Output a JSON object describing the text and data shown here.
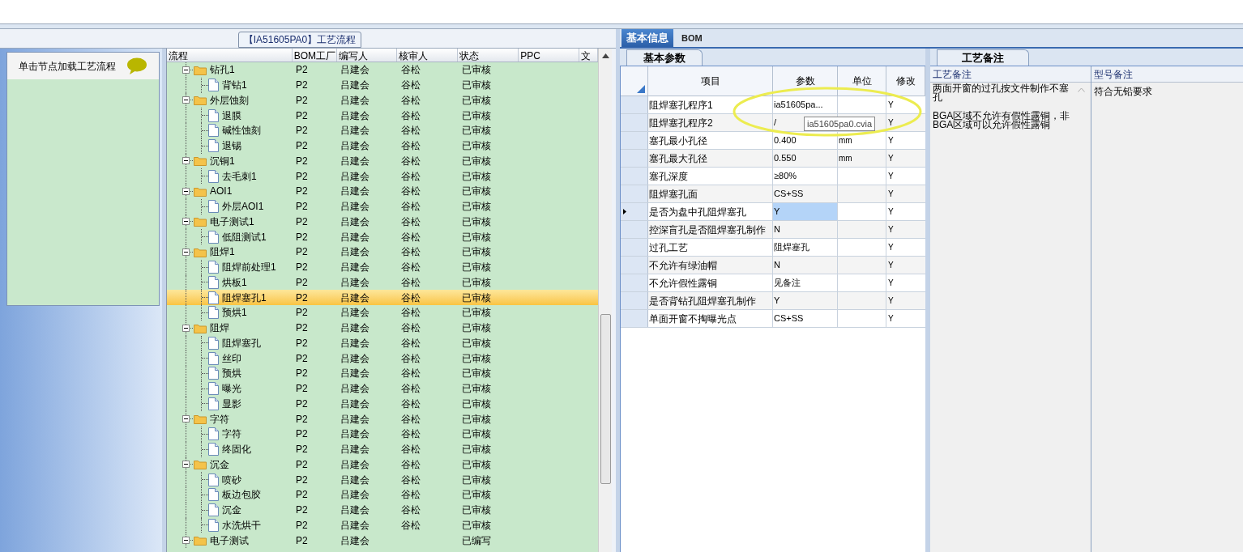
{
  "flow_title": "【IA51605PA0】工艺流程",
  "left_panel": {
    "hint": "单击节点加载工艺流程"
  },
  "tree": {
    "columns": [
      "流程",
      "BOM工厂",
      "编写人",
      "核审人",
      "状态",
      "PPC",
      "文"
    ],
    "rows": [
      {
        "name": "钻孔1",
        "bom": "P2",
        "writer": "吕建会",
        "reviewer": "谷松",
        "status": "已审核",
        "expanded": true,
        "selected": false,
        "children": [
          {
            "name": "背钻1",
            "bom": "P2",
            "writer": "吕建会",
            "reviewer": "谷松",
            "status": "已审核",
            "selected": false
          }
        ]
      },
      {
        "name": "外层蚀刻",
        "bom": "P2",
        "writer": "吕建会",
        "reviewer": "谷松",
        "status": "已审核",
        "expanded": true,
        "selected": false,
        "children": [
          {
            "name": "退膜",
            "bom": "P2",
            "writer": "吕建会",
            "reviewer": "谷松",
            "status": "已审核",
            "selected": false
          },
          {
            "name": "碱性蚀刻",
            "bom": "P2",
            "writer": "吕建会",
            "reviewer": "谷松",
            "status": "已审核",
            "selected": false
          },
          {
            "name": "退锡",
            "bom": "P2",
            "writer": "吕建会",
            "reviewer": "谷松",
            "status": "已审核",
            "selected": false
          }
        ]
      },
      {
        "name": "沉铜1",
        "bom": "P2",
        "writer": "吕建会",
        "reviewer": "谷松",
        "status": "已审核",
        "expanded": true,
        "selected": false,
        "children": [
          {
            "name": "去毛刺1",
            "bom": "P2",
            "writer": "吕建会",
            "reviewer": "谷松",
            "status": "已审核",
            "selected": false
          }
        ]
      },
      {
        "name": "AOI1",
        "bom": "P2",
        "writer": "吕建会",
        "reviewer": "谷松",
        "status": "已审核",
        "expanded": true,
        "selected": false,
        "children": [
          {
            "name": "外层AOI1",
            "bom": "P2",
            "writer": "吕建会",
            "reviewer": "谷松",
            "status": "已审核",
            "selected": false
          }
        ]
      },
      {
        "name": "电子测试1",
        "bom": "P2",
        "writer": "吕建会",
        "reviewer": "谷松",
        "status": "已审核",
        "expanded": true,
        "selected": false,
        "children": [
          {
            "name": "低阻测试1",
            "bom": "P2",
            "writer": "吕建会",
            "reviewer": "谷松",
            "status": "已审核",
            "selected": false
          }
        ]
      },
      {
        "name": "阻焊1",
        "bom": "P2",
        "writer": "吕建会",
        "reviewer": "谷松",
        "status": "已审核",
        "expanded": true,
        "selected": false,
        "children": [
          {
            "name": "阻焊前处理1",
            "bom": "P2",
            "writer": "吕建会",
            "reviewer": "谷松",
            "status": "已审核",
            "selected": false
          },
          {
            "name": "烘板1",
            "bom": "P2",
            "writer": "吕建会",
            "reviewer": "谷松",
            "status": "已审核",
            "selected": false
          },
          {
            "name": "阻焊塞孔1",
            "bom": "P2",
            "writer": "吕建会",
            "reviewer": "谷松",
            "status": "已审核",
            "selected": true
          },
          {
            "name": "预烘1",
            "bom": "P2",
            "writer": "吕建会",
            "reviewer": "谷松",
            "status": "已审核",
            "selected": false
          }
        ]
      },
      {
        "name": "阻焊",
        "bom": "P2",
        "writer": "吕建会",
        "reviewer": "谷松",
        "status": "已审核",
        "expanded": true,
        "selected": false,
        "children": [
          {
            "name": "阻焊塞孔",
            "bom": "P2",
            "writer": "吕建会",
            "reviewer": "谷松",
            "status": "已审核",
            "selected": false
          },
          {
            "name": "丝印",
            "bom": "P2",
            "writer": "吕建会",
            "reviewer": "谷松",
            "status": "已审核",
            "selected": false
          },
          {
            "name": "预烘",
            "bom": "P2",
            "writer": "吕建会",
            "reviewer": "谷松",
            "status": "已审核",
            "selected": false
          },
          {
            "name": "曝光",
            "bom": "P2",
            "writer": "吕建会",
            "reviewer": "谷松",
            "status": "已审核",
            "selected": false
          },
          {
            "name": "显影",
            "bom": "P2",
            "writer": "吕建会",
            "reviewer": "谷松",
            "status": "已审核",
            "selected": false
          }
        ]
      },
      {
        "name": "字符",
        "bom": "P2",
        "writer": "吕建会",
        "reviewer": "谷松",
        "status": "已审核",
        "expanded": true,
        "selected": false,
        "children": [
          {
            "name": "字符",
            "bom": "P2",
            "writer": "吕建会",
            "reviewer": "谷松",
            "status": "已审核",
            "selected": false
          },
          {
            "name": "终固化",
            "bom": "P2",
            "writer": "吕建会",
            "reviewer": "谷松",
            "status": "已审核",
            "selected": false
          }
        ]
      },
      {
        "name": "沉金",
        "bom": "P2",
        "writer": "吕建会",
        "reviewer": "谷松",
        "status": "已审核",
        "expanded": true,
        "selected": false,
        "children": [
          {
            "name": "喷砂",
            "bom": "P2",
            "writer": "吕建会",
            "reviewer": "谷松",
            "status": "已审核",
            "selected": false
          },
          {
            "name": "板边包胶",
            "bom": "P2",
            "writer": "吕建会",
            "reviewer": "谷松",
            "status": "已审核",
            "selected": false
          },
          {
            "name": "沉金",
            "bom": "P2",
            "writer": "吕建会",
            "reviewer": "谷松",
            "status": "已审核",
            "selected": false
          },
          {
            "name": "水洗烘干",
            "bom": "P2",
            "writer": "吕建会",
            "reviewer": "谷松",
            "status": "已审核",
            "selected": false
          }
        ]
      },
      {
        "name": "电子测试",
        "bom": "P2",
        "writer": "吕建会",
        "status": "已编写",
        "expanded": true,
        "selected": false
      }
    ]
  },
  "main_tabs": [
    {
      "label": "基本信息",
      "selected": true
    },
    {
      "label": "BOM",
      "selected": false
    }
  ],
  "params": {
    "tab": "基本参数",
    "columns": [
      "项目",
      "参数",
      "单位",
      "修改"
    ],
    "rows": [
      {
        "item": "阻焊塞孔程序1",
        "value": "ia51605pa...",
        "modified": "Y",
        "selected": false
      },
      {
        "item": "阻焊塞孔程序2",
        "value": "/",
        "modified": "Y",
        "selected": false
      },
      {
        "item": "塞孔最小孔径",
        "value": "0.400",
        "unit": "mm",
        "modified": "Y",
        "selected": false
      },
      {
        "item": "塞孔最大孔径",
        "value": "0.550",
        "unit": "mm",
        "modified": "Y",
        "selected": false
      },
      {
        "item": "塞孔深度",
        "value": "≥80%",
        "modified": "Y",
        "selected": false
      },
      {
        "item": "阻焊塞孔面",
        "value": "CS+SS",
        "modified": "Y",
        "selected": false
      },
      {
        "item": "是否为盘中孔阻焊塞孔",
        "value": "Y",
        "modified": "Y",
        "selected": true
      },
      {
        "item": "控深盲孔是否阻焊塞孔制作",
        "value": "N",
        "modified": "Y",
        "selected": false
      },
      {
        "item": "过孔工艺",
        "value": "阻焊塞孔",
        "modified": "Y",
        "selected": false
      },
      {
        "item": "不允许有绿油帽",
        "value": "N",
        "modified": "Y",
        "selected": false
      },
      {
        "item": "不允许假性露铜",
        "value": "见备注",
        "modified": "Y",
        "selected": false
      },
      {
        "item": "是否背钻孔阻焊塞孔制作",
        "value": "Y",
        "modified": "Y",
        "selected": false
      },
      {
        "item": "单面开窗不掏曝光点",
        "value": "CS+SS",
        "modified": "Y",
        "selected": false
      }
    ],
    "tooltip": "ia51605pa0.cvia"
  },
  "notes": {
    "tab": "工艺备注",
    "columns": [
      "工艺备注",
      "型号备注"
    ],
    "process_note": [
      "两面开窗的过孔按文件制作不塞孔",
      "BGA区域不允许有假性露铜，非BGA区域可以允许假性露铜"
    ],
    "model_note": "符合无铅要求"
  }
}
